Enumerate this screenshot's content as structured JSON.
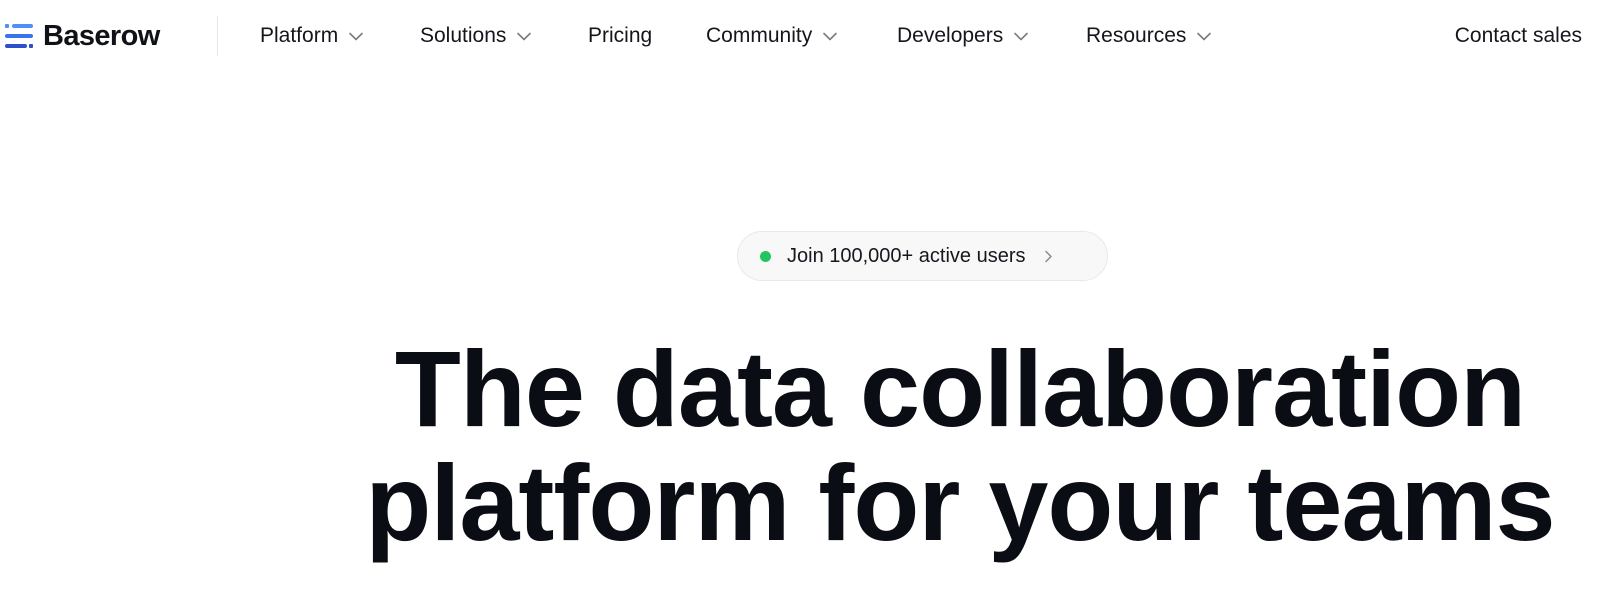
{
  "brand": {
    "name": "Baserow",
    "logo_colors": [
      "#4f8ff7",
      "#3366e8",
      "#2d4fc9"
    ]
  },
  "nav": {
    "items": [
      {
        "label": "Platform",
        "has_dropdown": true
      },
      {
        "label": "Solutions",
        "has_dropdown": true
      },
      {
        "label": "Pricing",
        "has_dropdown": false
      },
      {
        "label": "Community",
        "has_dropdown": true
      },
      {
        "label": "Developers",
        "has_dropdown": true
      },
      {
        "label": "Resources",
        "has_dropdown": true
      }
    ],
    "contact_label": "Contact sales"
  },
  "badge": {
    "text": "Join 100,000+ active users",
    "dot_color": "#22c55e",
    "icon": "chevron-right-icon"
  },
  "hero": {
    "line1": "The data collaboration",
    "line2": "platform for your teams"
  }
}
